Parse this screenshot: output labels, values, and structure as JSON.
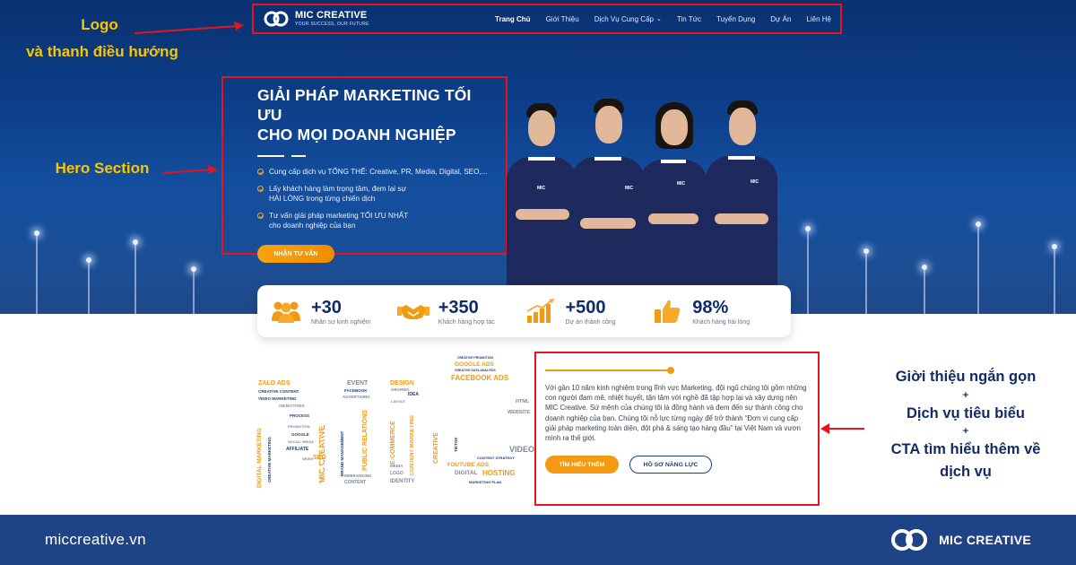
{
  "annotations": {
    "logo_line1": "Logo",
    "logo_line2": "và thanh điều hướng",
    "hero": "Hero Section",
    "right_line1": "Giời thiệu ngắn gọn",
    "right_line2": "+",
    "right_line3": "Dịch vụ tiêu biểu",
    "right_line4": "+",
    "right_line5": "CTA tìm hiểu thêm về",
    "right_line6": "dịch vụ"
  },
  "nav": {
    "logo_name": "MIC CREATIVE",
    "logo_slogan": "YOUR SUCCESS, OUR FUTURE",
    "items": [
      {
        "label": "Trang Chủ"
      },
      {
        "label": "Giới Thiệu"
      },
      {
        "label": "Dịch Vụ Cung Cấp"
      },
      {
        "label": "Tin Tức"
      },
      {
        "label": "Tuyển Dụng"
      },
      {
        "label": "Dự Án"
      },
      {
        "label": "Liên Hệ"
      }
    ]
  },
  "hero": {
    "title_line1": "GIẢI PHÁP MARKETING TỐI ƯU",
    "title_line2": "CHO MỌI DOANH NGHIỆP",
    "bullets": [
      {
        "line1": "Cung cấp dịch vụ TỔNG THỂ: Creative, PR, Media, Digital, SEO,...",
        "line2": ""
      },
      {
        "line1": "Lấy khách hàng làm trọng tâm, đem lại sự",
        "line2": "HÀI LÒNG trong từng chiến dịch"
      },
      {
        "line1": "Tư vấn giải pháp marketing TỐI ƯU NHẤT",
        "line2": "cho doanh nghiệp của bạn"
      }
    ],
    "cta_label": "NHẬN TƯ VẤN",
    "shirt_logo": "MIC"
  },
  "stats": [
    {
      "value": "+30",
      "label": "Nhân sự kinh nghiệm",
      "icon": "team-icon"
    },
    {
      "value": "+350",
      "label": "Khách hàng hợp tác",
      "icon": "handshake-icon"
    },
    {
      "value": "+500",
      "label": "Dự án thành công",
      "icon": "growth-chart-icon"
    },
    {
      "value": "98%",
      "label": "Khách hàng hài lòng",
      "icon": "thumbs-up-icon"
    }
  ],
  "wordcloud": {
    "w1": "ZALO ADS",
    "w2": "CREATIVE CONTENT",
    "w3": "VIDEO MARKETING",
    "w4": "OBJECTIVES",
    "w5": "PROCESS",
    "w6": "PROMOTION",
    "w7": "GOOGLE",
    "w8": "SOCIAL MEDIA",
    "w9": "AFFILIATE",
    "w10": "SEO",
    "w11": "DIGITAL MARKETING",
    "w12": "MIC CREATIVE",
    "w13": "EVENT",
    "w14": "FACEBOOK",
    "w15": "ADVERTISING",
    "w16": "PUBLIC RELATIONS",
    "w17": "REBRANDING",
    "w18": "CONTENT",
    "w19": "DESIGN",
    "w20": "GRAPHIC",
    "w21": "IDEA",
    "w22": "LAYOUT",
    "w23": "E-COMMERCE",
    "w24": "CONTENT MARKETING",
    "w25": "MEDIA",
    "w26": "LOGO",
    "w27": "IDENTITY",
    "w28": "GOOGLE ADS",
    "w29": "FACEBOOK ADS",
    "w30": "CREATIVE",
    "w31": "YOUTUBE ADS",
    "w32": "DIGITAL",
    "w33": "HOSTING",
    "w34": "HTML",
    "w35": "WEBSITE",
    "w36": "VIDEO",
    "w37": "TIKTOK",
    "w38": "MARKETING PLAN",
    "w39": "CREATIVE MARKETING",
    "w40": "BRAND MANAGEMENT",
    "w41": "CONTENT STRATEGY",
    "w42": "CREATIVE PROMOTION",
    "w43": "CREATIVE DATA ANALYSIS",
    "w44": "NEWS"
  },
  "intro": {
    "text": "Với gần 10 năm kinh nghiệm trong lĩnh vực Marketing, đội ngũ chúng tôi gồm những con người đam mê, nhiệt huyết, tận tâm với nghề đã tập hợp lại và xây dựng nên MIC Creative. Sứ mệnh của chúng tôi là đồng hành và đem đến sự thành công cho doanh nghiệp của bạn. Chúng tôi nỗ lực từng ngày để trở thành “Đơn vị cung cấp giải pháp marketing toàn diện, đột phá & sáng tạo hàng đầu” tại Việt Nam và vươn mình ra thế giới.",
    "btn_primary": "TÌM HIỂU THÊM",
    "btn_outline": "HỒ SƠ NĂNG LỰC"
  },
  "footer": {
    "site": "miccreative.vn",
    "brand": "MIC CREATIVE"
  },
  "colors": {
    "accent_orange": "#f39a12",
    "navy": "#1e4386",
    "annotation_red": "#e4161c",
    "annotation_yellow": "#f7c600"
  }
}
